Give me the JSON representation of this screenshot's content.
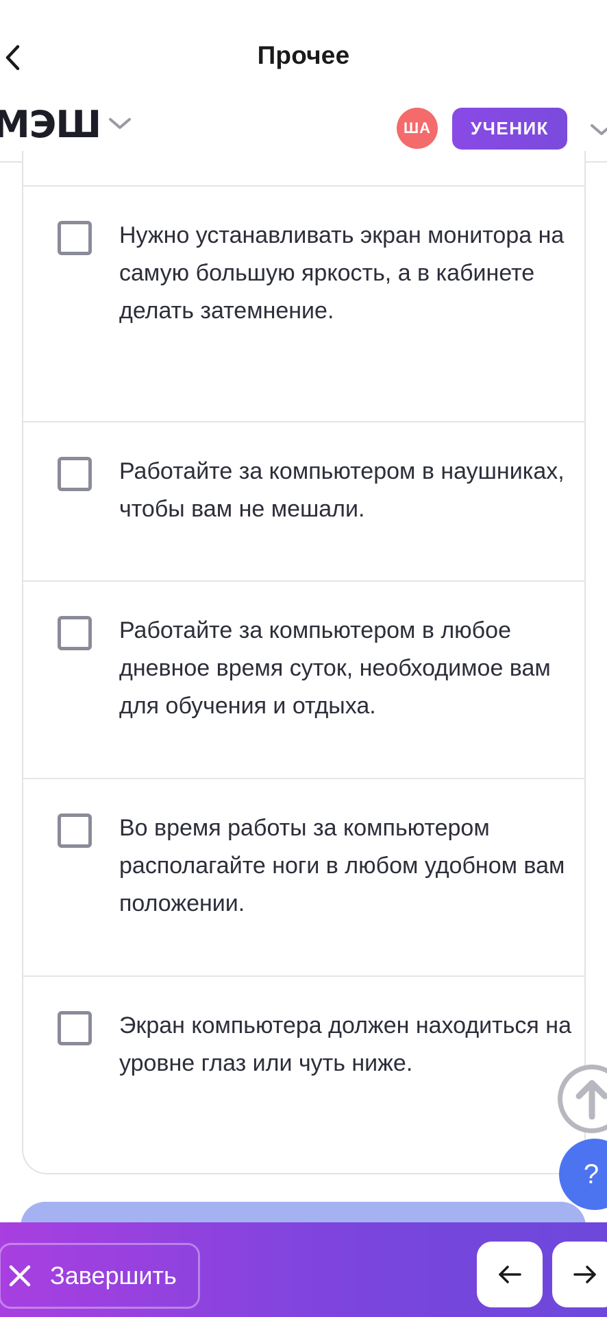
{
  "nav": {
    "title": "Прочее"
  },
  "header": {
    "logo": "МЭШ",
    "avatar_initials": "ША",
    "role": "УЧЕНИК"
  },
  "options": [
    {
      "text": "Нужно устанавливать экран монитора на самую большую яркость, а в кабинете делать затемнение."
    },
    {
      "text": "Работайте за компьютером в наушниках, чтобы вам не мешали."
    },
    {
      "text": "Работайте за компьютером в любое дневное время суток, необходимое вам для обучения и отдыха."
    },
    {
      "text": "Во время работы за компьютером располагайте ноги в любом удобном вам положении."
    },
    {
      "text": "Экран компьютера должен находиться на уровне глаз или чуть ниже."
    }
  ],
  "help": {
    "label": "?"
  },
  "bottom": {
    "finish_label": "Завершить"
  }
}
